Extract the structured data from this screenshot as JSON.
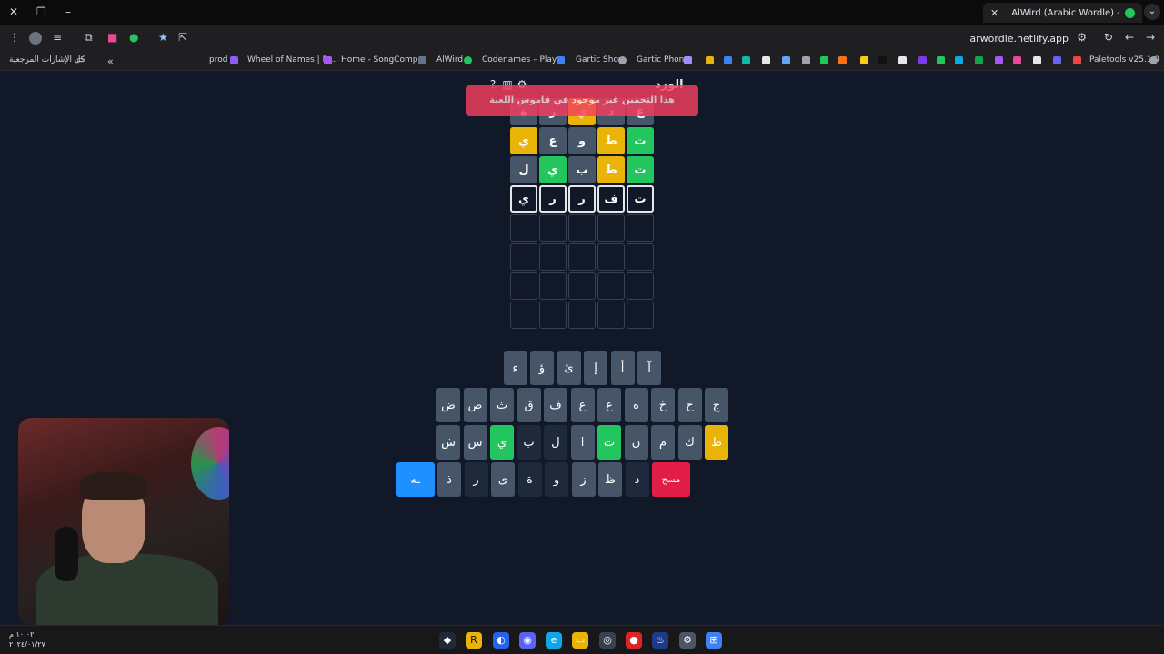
{
  "browser": {
    "tab_title": "AlWird (Arabic Wordle) - الورد",
    "url": "arwordle.netlify.app",
    "bookmarks": [
      {
        "label": "كل الإشارات المرجعية"
      },
      {
        "label": "prod"
      },
      {
        "label": "Wheel of Names | R..."
      },
      {
        "label": "Home - SongComp..."
      },
      {
        "label": "AlWird"
      },
      {
        "label": "Codenames – Play..."
      },
      {
        "label": "Gartic Show"
      },
      {
        "label": "Gartic Phone"
      },
      {
        "label": "Paletools v25.1.9"
      }
    ]
  },
  "game": {
    "title": "الورد",
    "toast": "هذا التخمين غير موجود في قاموس اللعبة",
    "icons": [
      "help-icon",
      "stats-icon",
      "settings-icon"
    ],
    "board": [
      [
        {
          "l": "غ",
          "s": "absent"
        },
        {
          "l": "د",
          "s": "absent"
        },
        {
          "l": "ي",
          "s": "present"
        },
        {
          "l": "ر",
          "s": "absent"
        },
        {
          "l": "ة",
          "s": "absent"
        }
      ],
      [
        {
          "l": "ت",
          "s": "correct"
        },
        {
          "l": "ط",
          "s": "present"
        },
        {
          "l": "و",
          "s": "absent"
        },
        {
          "l": "ع",
          "s": "absent"
        },
        {
          "l": "ي",
          "s": "present"
        }
      ],
      [
        {
          "l": "ت",
          "s": "correct"
        },
        {
          "l": "ط",
          "s": "present"
        },
        {
          "l": "ب",
          "s": "absent"
        },
        {
          "l": "ي",
          "s": "correct"
        },
        {
          "l": "ل",
          "s": "absent"
        }
      ],
      [
        {
          "l": "ت",
          "s": "typed"
        },
        {
          "l": "ف",
          "s": "typed"
        },
        {
          "l": "ر",
          "s": "typed"
        },
        {
          "l": "ر",
          "s": "typed"
        },
        {
          "l": "ي",
          "s": "typed"
        }
      ],
      [
        {
          "l": "",
          "s": "empty"
        },
        {
          "l": "",
          "s": "empty"
        },
        {
          "l": "",
          "s": "empty"
        },
        {
          "l": "",
          "s": "empty"
        },
        {
          "l": "",
          "s": "empty"
        }
      ],
      [
        {
          "l": "",
          "s": "empty"
        },
        {
          "l": "",
          "s": "empty"
        },
        {
          "l": "",
          "s": "empty"
        },
        {
          "l": "",
          "s": "empty"
        },
        {
          "l": "",
          "s": "empty"
        }
      ],
      [
        {
          "l": "",
          "s": "empty"
        },
        {
          "l": "",
          "s": "empty"
        },
        {
          "l": "",
          "s": "empty"
        },
        {
          "l": "",
          "s": "empty"
        },
        {
          "l": "",
          "s": "empty"
        }
      ],
      [
        {
          "l": "",
          "s": "empty"
        },
        {
          "l": "",
          "s": "empty"
        },
        {
          "l": "",
          "s": "empty"
        },
        {
          "l": "",
          "s": "empty"
        },
        {
          "l": "",
          "s": "empty"
        }
      ]
    ],
    "keyboard": [
      [
        {
          "l": "آ",
          "s": "unused"
        },
        {
          "l": "أ",
          "s": "unused"
        },
        {
          "l": "إ",
          "s": "unused"
        },
        {
          "l": "ئ",
          "s": "unused"
        },
        {
          "l": "ؤ",
          "s": "unused"
        },
        {
          "l": "ء",
          "s": "unused"
        }
      ],
      [
        {
          "l": "ج",
          "s": "unused"
        },
        {
          "l": "ح",
          "s": "unused"
        },
        {
          "l": "خ",
          "s": "unused"
        },
        {
          "l": "ه",
          "s": "unused"
        },
        {
          "l": "ع",
          "s": "unused"
        },
        {
          "l": "غ",
          "s": "unused"
        },
        {
          "l": "ف",
          "s": "unused"
        },
        {
          "l": "ق",
          "s": "unused"
        },
        {
          "l": "ث",
          "s": "unused"
        },
        {
          "l": "ص",
          "s": "unused"
        },
        {
          "l": "ض",
          "s": "unused"
        }
      ],
      [
        {
          "l": "ط",
          "s": "present"
        },
        {
          "l": "ك",
          "s": "unused"
        },
        {
          "l": "م",
          "s": "unused"
        },
        {
          "l": "ن",
          "s": "unused"
        },
        {
          "l": "ت",
          "s": "correct"
        },
        {
          "l": "ا",
          "s": "unused"
        },
        {
          "l": "ل",
          "s": "absent"
        },
        {
          "l": "ب",
          "s": "absent"
        },
        {
          "l": "ي",
          "s": "correct"
        },
        {
          "l": "س",
          "s": "unused"
        },
        {
          "l": "ش",
          "s": "unused"
        }
      ],
      [
        {
          "l": "مسح",
          "s": "delete"
        },
        {
          "l": "د",
          "s": "absent"
        },
        {
          "l": "ظ",
          "s": "unused"
        },
        {
          "l": "ز",
          "s": "unused"
        },
        {
          "l": "و",
          "s": "absent"
        },
        {
          "l": "ة",
          "s": "absent"
        },
        {
          "l": "ى",
          "s": "unused"
        },
        {
          "l": "ر",
          "s": "absent"
        },
        {
          "l": "ذ",
          "s": "unused"
        },
        {
          "l": "ـه",
          "s": "enter"
        }
      ]
    ]
  },
  "taskbar": {
    "time": "١٠:٠٢ م",
    "date": "٢٠٢٤/٠١/٢٧"
  }
}
